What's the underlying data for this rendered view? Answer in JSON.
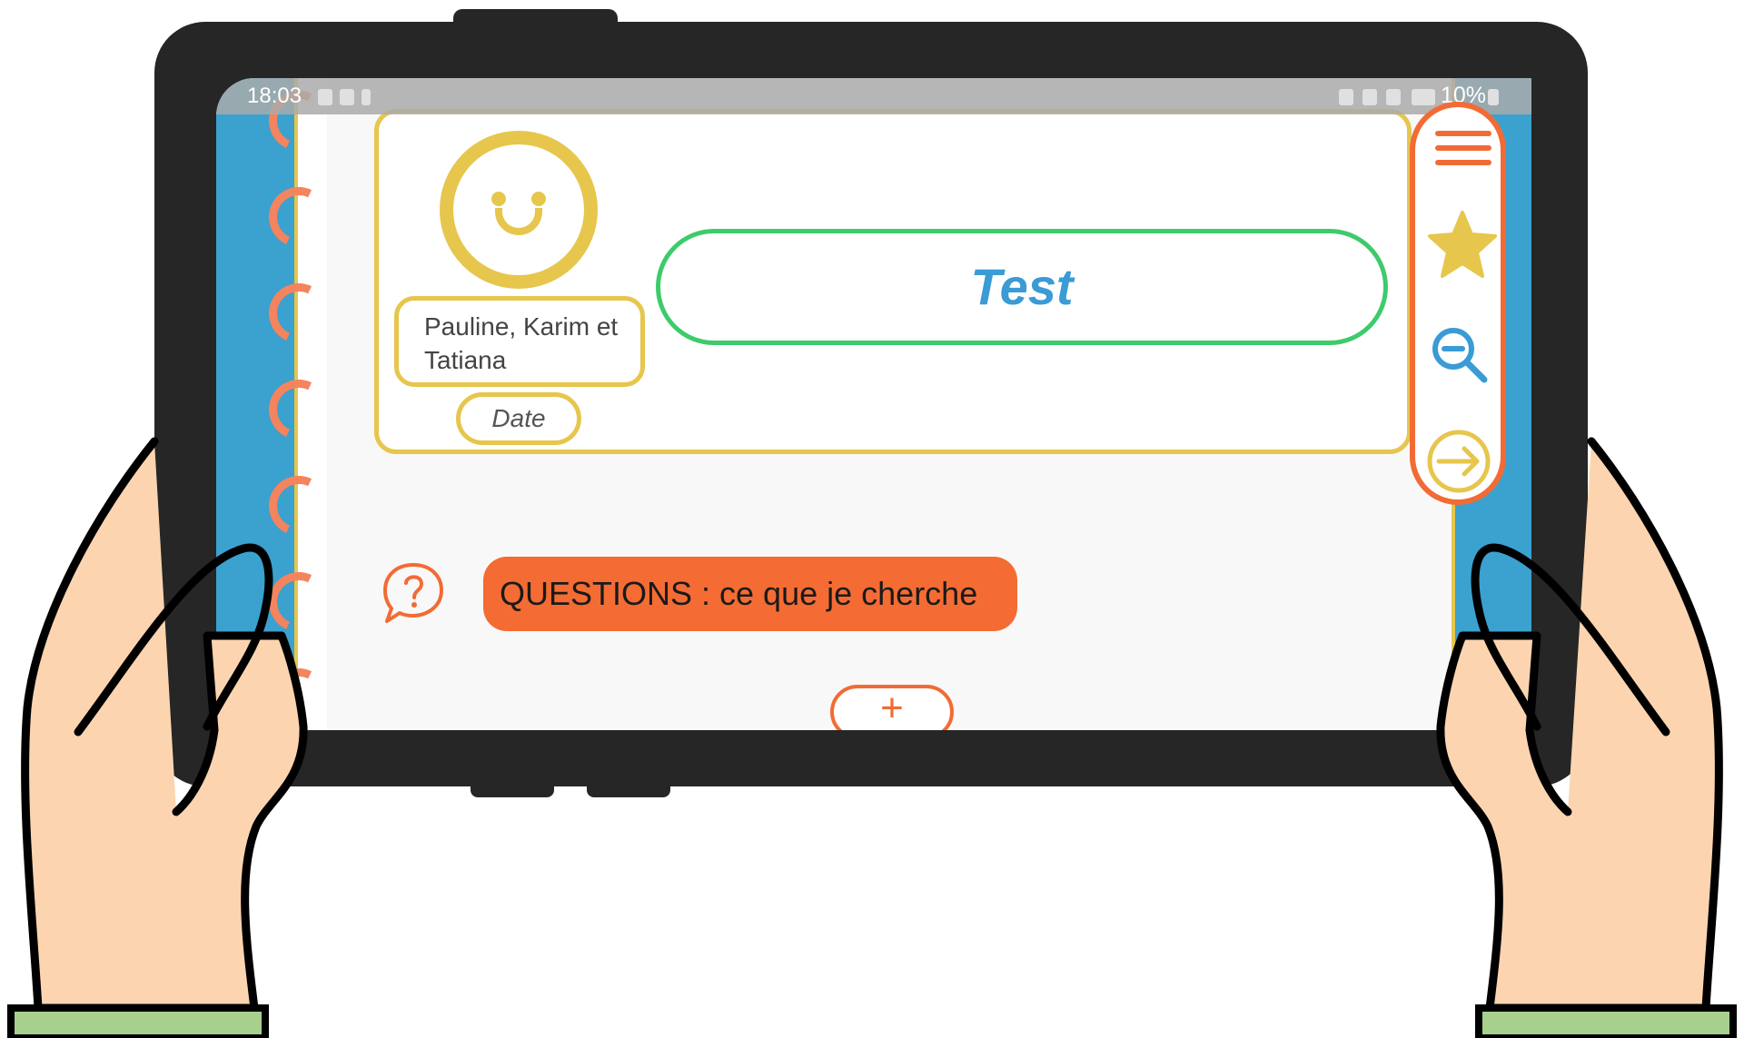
{
  "status_bar": {
    "time": "18:03",
    "battery": "10%"
  },
  "card": {
    "names": "Pauline, Karim et Tatiana",
    "date_placeholder": "Date",
    "title": "Test"
  },
  "side_menu": {
    "icons": [
      "menu-icon",
      "star-icon",
      "zoom-out-icon",
      "exit-arrow-icon"
    ]
  },
  "section": {
    "label": "QUESTIONS : ce que je cherche",
    "add_label": "+"
  },
  "colors": {
    "accent_orange": "#f26b35",
    "frame_yellow": "#e6c64c",
    "title_border_green": "#3dcb6b",
    "title_text_blue": "#3a9bd5",
    "notebook_blue": "#3ba1cf",
    "tablet": "#262626",
    "skin": "#fcd5b0",
    "sleeve": "#a7d08c"
  }
}
